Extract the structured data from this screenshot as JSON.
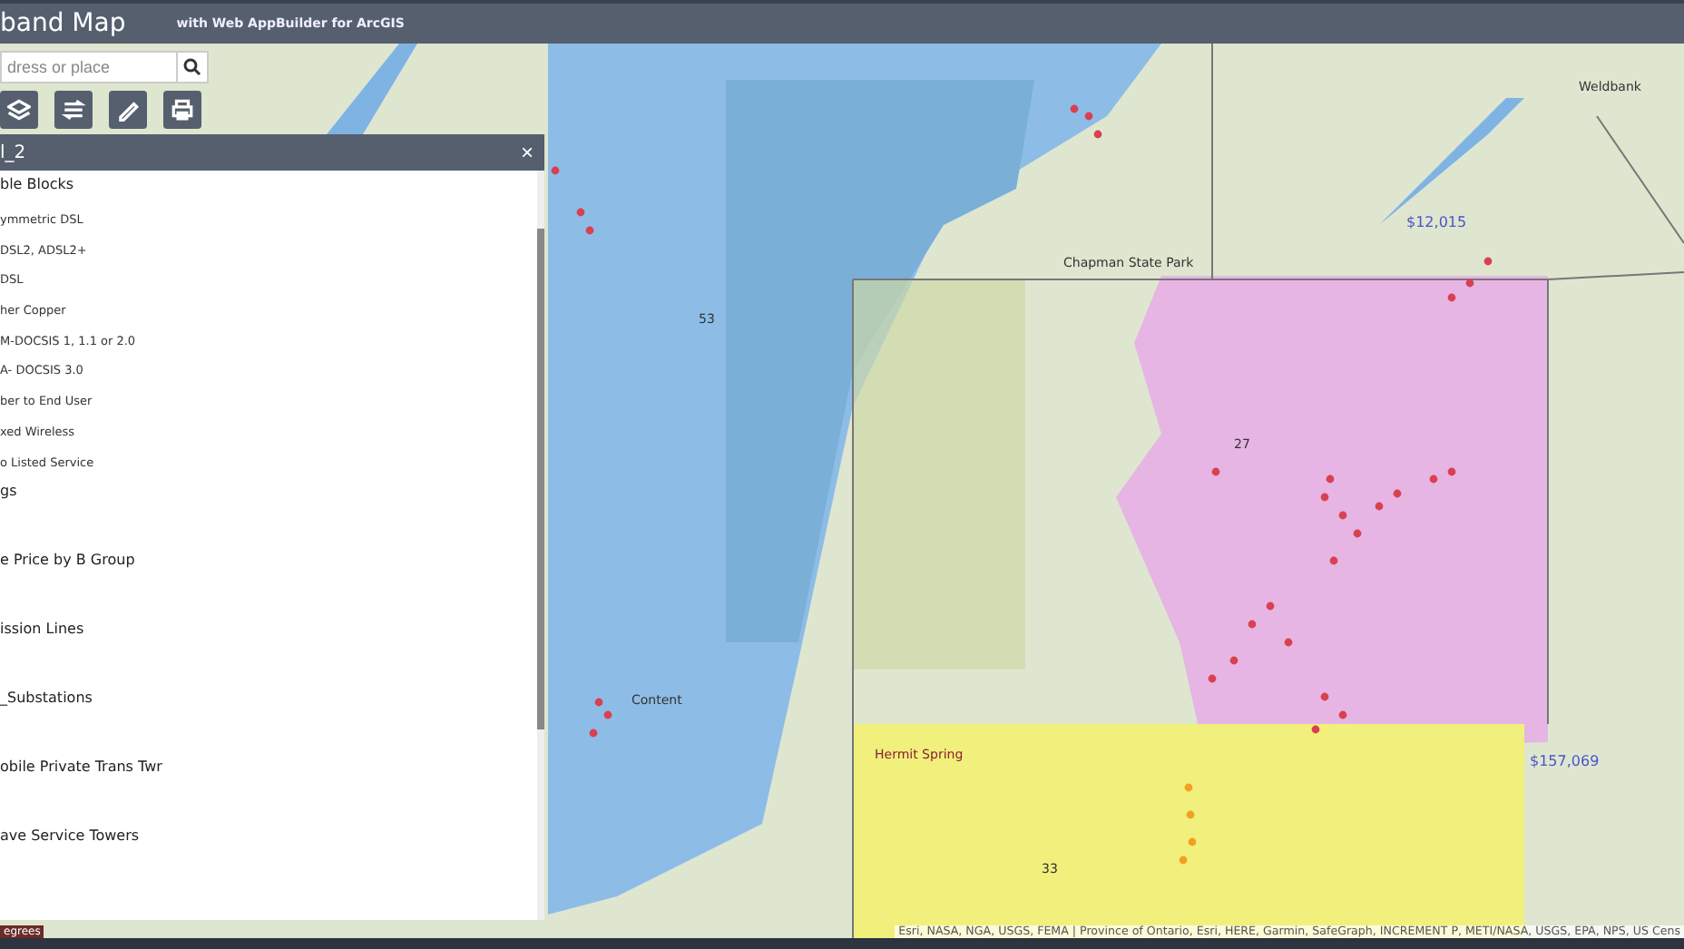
{
  "header": {
    "title": "band Map",
    "subtitle": "with Web AppBuilder for ArcGIS"
  },
  "search": {
    "placeholder": "dress or place"
  },
  "tools": [
    {
      "kind": "layers"
    },
    {
      "kind": "swap"
    },
    {
      "kind": "draw"
    },
    {
      "kind": "print"
    }
  ],
  "panel": {
    "title": "l_2",
    "close": "×",
    "layers": [
      {
        "label": "ble Blocks",
        "children": [
          {
            "label": "ymmetric DSL"
          },
          {
            "label": "DSL2, ADSL2+"
          },
          {
            "label": "DSL"
          },
          {
            "label": "her Copper"
          },
          {
            "label": "M-DOCSIS 1, 1.1 or 2.0"
          },
          {
            "label": "A- DOCSIS 3.0"
          },
          {
            "label": "ber to End User"
          },
          {
            "label": "xed Wireless"
          },
          {
            "label": "o Listed Service"
          }
        ]
      },
      {
        "label": "gs"
      },
      {
        "label": "e Price by B Group"
      },
      {
        "label": "ission Lines"
      },
      {
        "label": "_Substations"
      },
      {
        "label": "obile Private Trans Twr"
      },
      {
        "label": "ave Service Towers"
      }
    ]
  },
  "map_labels": [
    {
      "text": "Weldbank",
      "kind": "place"
    },
    {
      "text": "$12,015",
      "kind": "value"
    },
    {
      "text": "Chapman State Park",
      "kind": "place"
    },
    {
      "text": "$157,069",
      "kind": "value"
    },
    {
      "text": "Hermit Spring",
      "kind": "spring"
    },
    {
      "text": "Content",
      "kind": "place"
    },
    {
      "text": "27",
      "kind": "road"
    },
    {
      "text": "53",
      "kind": "road"
    },
    {
      "text": "33",
      "kind": "road"
    }
  ],
  "scale_badge": "egrees",
  "attribution": "Esri, NASA, NGA, USGS, FEMA | Province of Ontario, Esri, HERE, Garmin, SafeGraph, INCREMENT P, METI/NASA, USGS, EPA, NPS, US Cens"
}
